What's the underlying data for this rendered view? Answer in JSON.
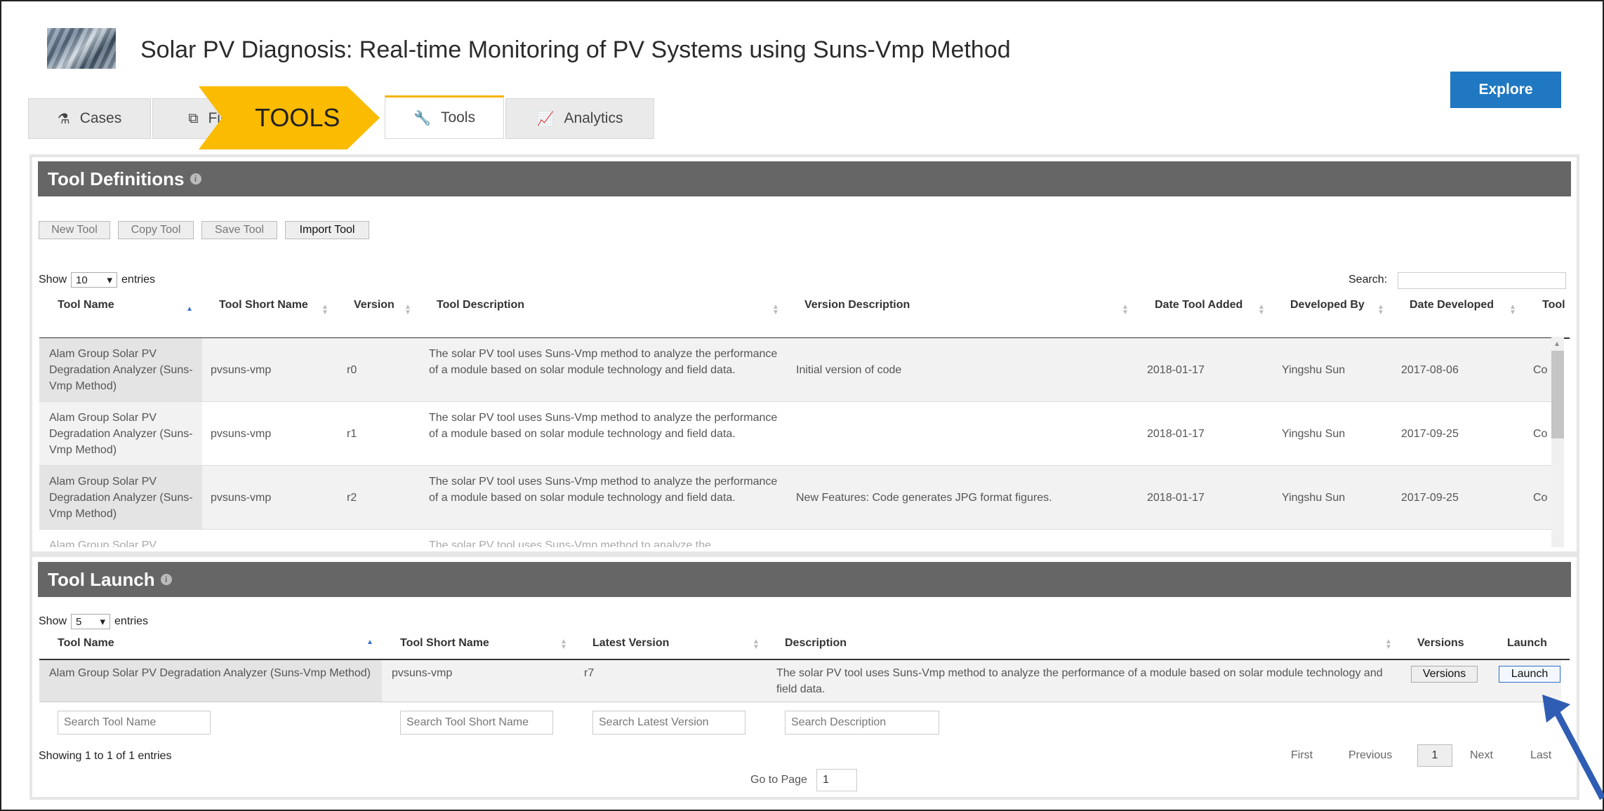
{
  "header": {
    "title": "Solar PV Diagnosis: Real-time Monitoring of PV Systems using Suns-Vmp Method",
    "explore_label": "Explore"
  },
  "tabs": [
    {
      "label": "Cases",
      "icon": "flask-icon"
    },
    {
      "label": "Files",
      "icon": "files-icon"
    },
    {
      "label": "Tools",
      "icon": "wrench-icon",
      "active": true
    },
    {
      "label": "Analytics",
      "icon": "chart-icon"
    }
  ],
  "callout": {
    "label": "TOOLS",
    "color": "#fbbb00"
  },
  "tool_definitions": {
    "title": "Tool Definitions",
    "buttons": {
      "new": "New Tool",
      "copy": "Copy Tool",
      "save": "Save Tool",
      "import": "Import Tool"
    },
    "show_label": "Show",
    "entries_value": "10",
    "entries_label": "entries",
    "search_label": "Search:",
    "columns": [
      "Tool Name",
      "Tool Short Name",
      "Version",
      "Tool Description",
      "Version Description",
      "Date Tool Added",
      "Developed By",
      "Date Developed",
      "Tool"
    ],
    "rows": [
      {
        "name": "Alam Group Solar PV Degradation Analyzer (Suns-Vmp Method)",
        "short": "pvsuns-vmp",
        "version": "r0",
        "desc": "The solar PV tool uses Suns-Vmp method to analyze the performance of a module based on solar module technology and field data.",
        "vdesc": "Initial version of code",
        "added": "2018-01-17",
        "dev_by": "Yingshu Sun",
        "dev_date": "2017-08-06",
        "tool": "Co"
      },
      {
        "name": "Alam Group Solar PV Degradation Analyzer (Suns-Vmp Method)",
        "short": "pvsuns-vmp",
        "version": "r1",
        "desc": "The solar PV tool uses Suns-Vmp method to analyze the performance of a module based on solar module technology and field data.",
        "vdesc": "",
        "added": "2018-01-17",
        "dev_by": "Yingshu Sun",
        "dev_date": "2017-09-25",
        "tool": "Co"
      },
      {
        "name": "Alam Group Solar PV Degradation Analyzer (Suns-Vmp Method)",
        "short": "pvsuns-vmp",
        "version": "r2",
        "desc": "The solar PV tool uses Suns-Vmp method to analyze the performance of a module based on solar module technology and field data.",
        "vdesc": "New Features: Code generates JPG format figures.",
        "added": "2018-01-17",
        "dev_by": "Yingshu Sun",
        "dev_date": "2017-09-25",
        "tool": "Co"
      }
    ],
    "partial_row": {
      "name": "Alam Group Solar PV",
      "desc": "The solar PV tool uses Suns-Vmp method to analyze the"
    }
  },
  "tool_launch": {
    "title": "Tool Launch",
    "show_label": "Show",
    "entries_value": "5",
    "entries_label": "entries",
    "columns": [
      "Tool Name",
      "Tool Short Name",
      "Latest Version",
      "Description",
      "Versions",
      "Launch"
    ],
    "row": {
      "name": "Alam Group Solar PV Degradation Analyzer (Suns-Vmp Method)",
      "short": "pvsuns-vmp",
      "latest": "r7",
      "desc": "The solar PV tool uses Suns-Vmp method to analyze the performance of a module based on solar module technology and field data.",
      "versions_btn": "Versions",
      "launch_btn": "Launch"
    },
    "filters": {
      "name": "Search Tool Name",
      "short": "Search Tool Short Name",
      "latest": "Search Latest Version",
      "desc": "Search Description"
    },
    "info": "Showing 1 to 1 of 1 entries",
    "pager": {
      "first": "First",
      "previous": "Previous",
      "current": "1",
      "next": "Next",
      "last": "Last"
    },
    "goto_label": "Go to Page",
    "goto_value": "1"
  }
}
